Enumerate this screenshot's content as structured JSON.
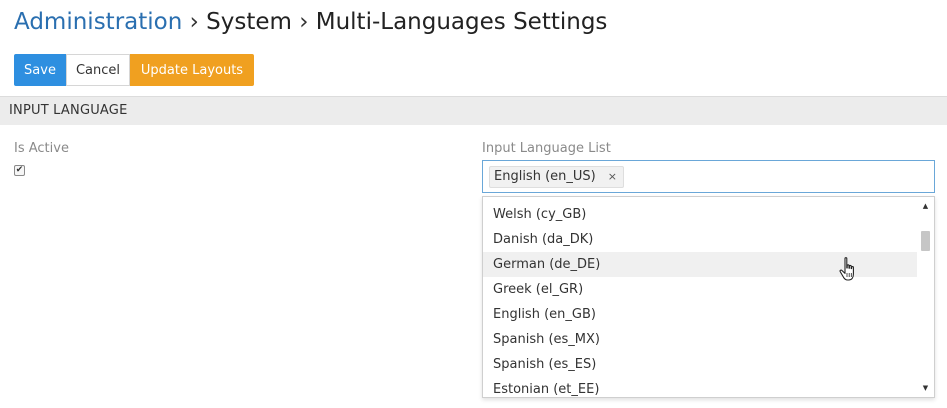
{
  "breadcrumb": {
    "root": "Administration",
    "sep1": "›",
    "middle": "System",
    "sep2": "›",
    "current": "Multi-Languages Settings"
  },
  "toolbar": {
    "save_label": "Save",
    "cancel_label": "Cancel",
    "update_layouts_label": "Update Layouts"
  },
  "panel": {
    "title": "INPUT LANGUAGE"
  },
  "fields": {
    "is_active_label": "Is Active",
    "is_active_checked": true,
    "checkbox_mark": "✔",
    "input_language_list_label": "Input Language List",
    "selected_tag": "English (en_US)",
    "tag_remove": "×"
  },
  "dropdown": {
    "items": [
      "Welsh (cy_GB)",
      "Danish (da_DK)",
      "German (de_DE)",
      "Greek (el_GR)",
      "English (en_GB)",
      "Spanish (es_MX)",
      "Spanish (es_ES)",
      "Estonian (et_EE)"
    ],
    "hovered_index": 2,
    "scroll_up_glyph": "▲",
    "scroll_down_glyph": "▼"
  },
  "colors": {
    "link": "#2a6fb0",
    "save": "#2e8fe0",
    "update": "#f0a020",
    "focus_border": "#6aa7d8"
  },
  "icons": {
    "cursor": "hand-pointer-icon",
    "tag_close": "close-icon",
    "scroll_up": "scroll-up-arrow-icon",
    "scroll_down": "scroll-down-arrow-icon"
  }
}
